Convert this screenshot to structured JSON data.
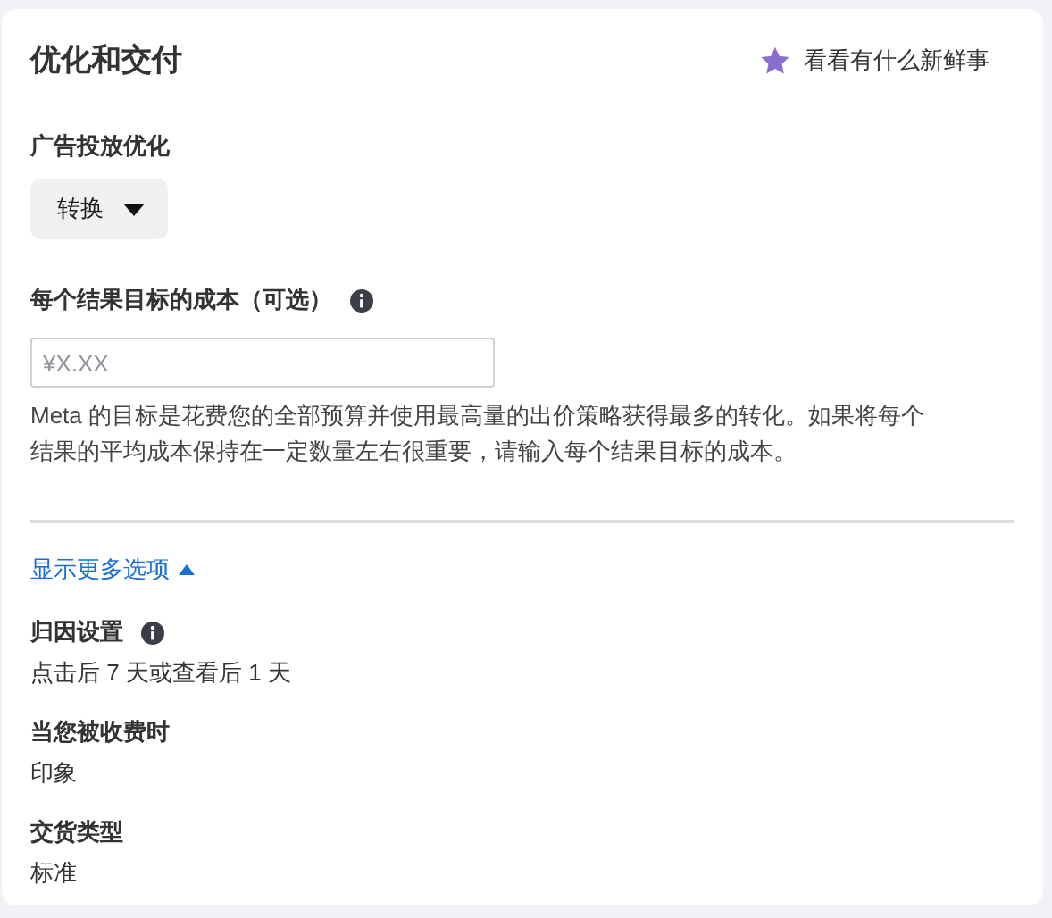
{
  "title": "优化和交付",
  "whats_new": {
    "label": "看看有什么新鲜事"
  },
  "optimization": {
    "label": "广告投放优化",
    "dropdown": {
      "value": "转换"
    }
  },
  "cost_per_result": {
    "label": "每个结果目标的成本（可选）",
    "info": true,
    "placeholder": "¥X.XX",
    "help": "Meta 的目标是花费您的全部预算并使用最高量的出价策略获得最多的转化。如果将每个结果的平均成本保持在一定数量左右很重要，请输入每个结果目标的成本。"
  },
  "more_options": {
    "label": "显示更多选项",
    "expanded": true
  },
  "settings": [
    {
      "label": "归因设置",
      "info": true,
      "value": "点击后 7 天或查看后 1 天"
    },
    {
      "label": "当您被收费时",
      "info": false,
      "value": "印象"
    },
    {
      "label": "交货类型",
      "info": false,
      "value": "标准"
    }
  ]
}
